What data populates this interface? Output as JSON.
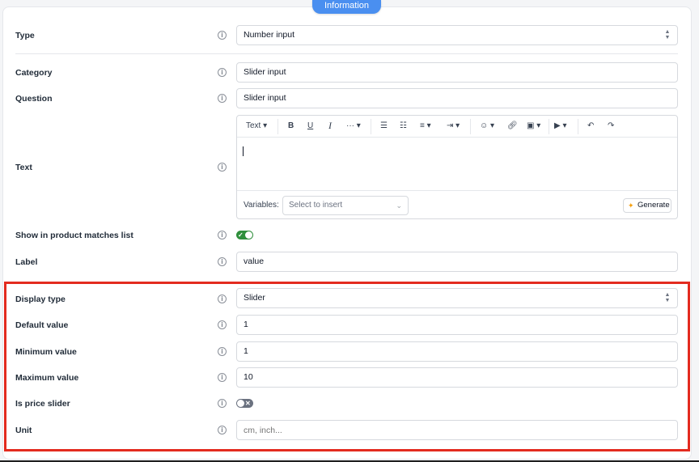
{
  "tab_label": "Information",
  "rows": {
    "type": {
      "label": "Type",
      "value": "Number input"
    },
    "category": {
      "label": "Category",
      "value": "Slider input"
    },
    "question": {
      "label": "Question",
      "value": "Slider input"
    },
    "text": {
      "label": "Text"
    },
    "show_in_matches": {
      "label": "Show in product matches list",
      "enabled": true
    },
    "label": {
      "label": "Label",
      "value": "value"
    },
    "display_type": {
      "label": "Display type",
      "value": "Slider"
    },
    "default_value": {
      "label": "Default value",
      "value": "1"
    },
    "minimum_value": {
      "label": "Minimum value",
      "value": "1"
    },
    "maximum_value": {
      "label": "Maximum value",
      "value": "10"
    },
    "is_price_slider": {
      "label": "Is price slider",
      "enabled": false
    },
    "unit": {
      "label": "Unit",
      "placeholder": "cm, inch..."
    }
  },
  "editor": {
    "text_style": "Text",
    "variables_label": "Variables:",
    "variables_placeholder": "Select to insert",
    "generate_label": "Generate"
  },
  "icons": {
    "info": "info-icon",
    "select_chevron": "chevron-updown-icon",
    "toggle_on": "check-icon",
    "toggle_off": "x-icon"
  },
  "colors": {
    "accent": "#4a8ff0",
    "toggle_on": "#2f8f3c",
    "toggle_off": "#6b7280",
    "highlight": "#e32b1f"
  }
}
